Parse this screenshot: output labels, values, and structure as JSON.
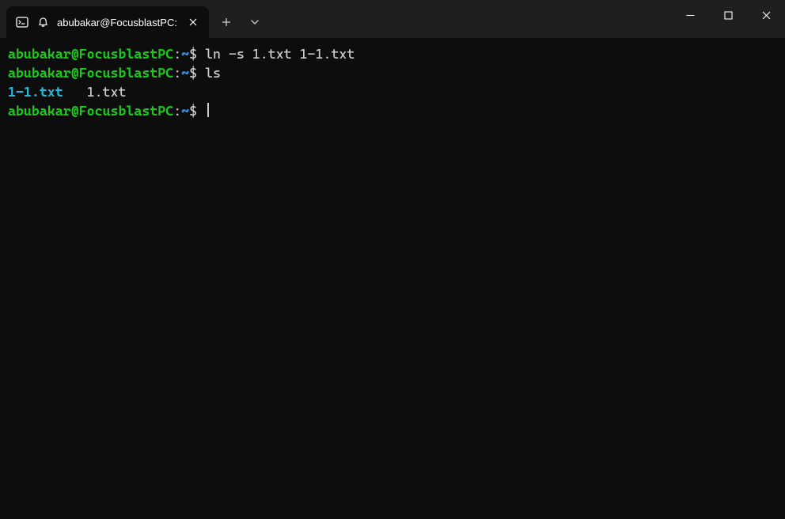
{
  "titlebar": {
    "tab": {
      "title": "abubakar@FocusblastPC:"
    }
  },
  "terminal": {
    "lines": [
      {
        "prompt_user": "abubakar@FocusblastPC",
        "prompt_colon": ":",
        "prompt_path": "~",
        "prompt_dollar": "$",
        "command": "ln -s 1.txt 1-1.txt"
      },
      {
        "prompt_user": "abubakar@FocusblastPC",
        "prompt_colon": ":",
        "prompt_path": "~",
        "prompt_dollar": "$",
        "command": "ls"
      }
    ],
    "ls_output": {
      "symlink": "1-1.txt",
      "spacer": "   ",
      "file": "1.txt"
    },
    "current_prompt": {
      "prompt_user": "abubakar@FocusblastPC",
      "prompt_colon": ":",
      "prompt_path": "~",
      "prompt_dollar": "$"
    }
  }
}
